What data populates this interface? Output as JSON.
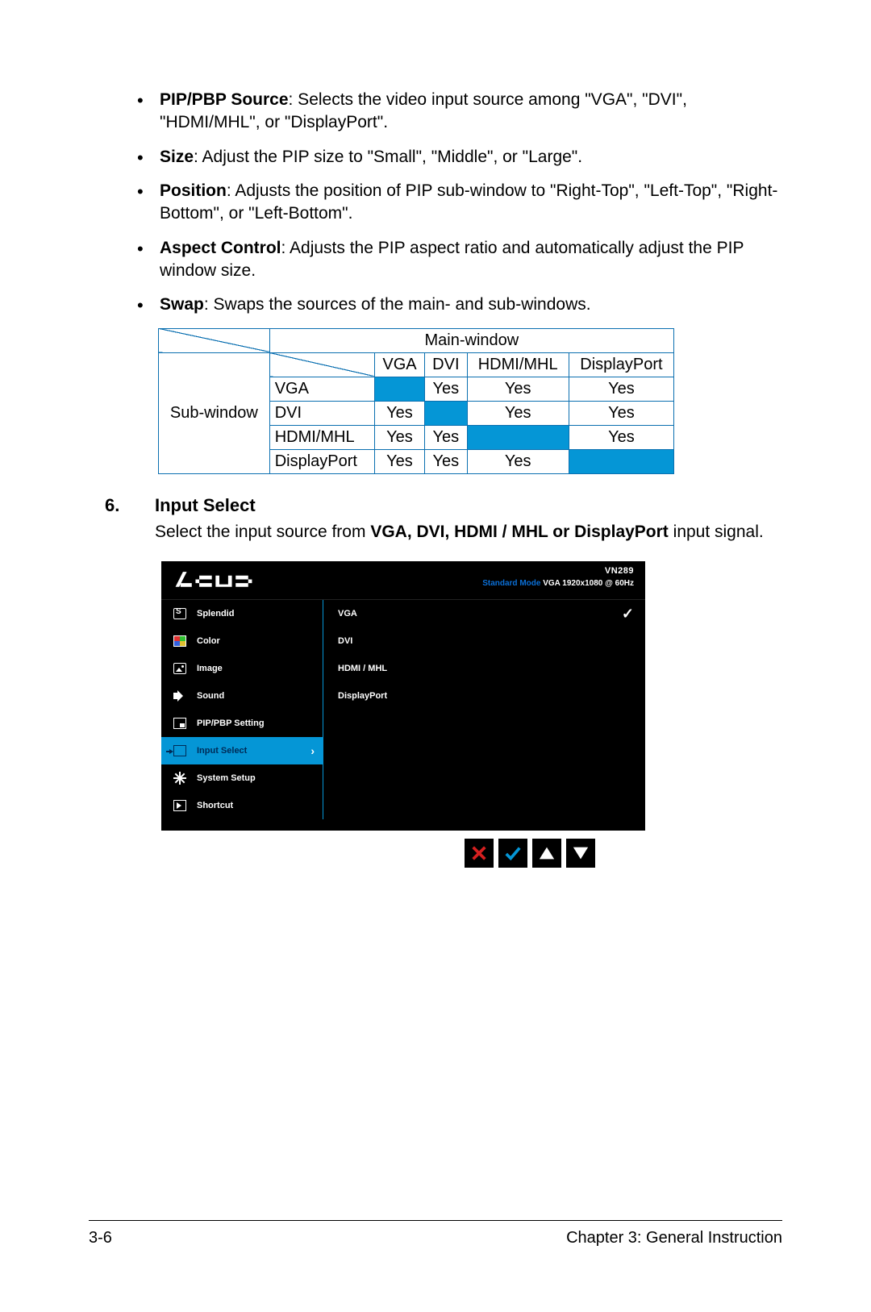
{
  "bullets": [
    {
      "label": "PIP/PBP Source",
      "text": ": Selects the video input source among \"VGA\", \"DVI\", \"HDMI/MHL\", or \"DisplayPort\"."
    },
    {
      "label": "Size",
      "text": ": Adjust the PIP size to \"Small\", \"Middle\", or \"Large\"."
    },
    {
      "label": "Position",
      "text": ": Adjusts the position of PIP sub-window to \"Right-Top\", \"Left-Top\", \"Right-Bottom\", or \"Left-Bottom\"."
    },
    {
      "label": "Aspect Control",
      "text": ": Adjusts the PIP aspect ratio and automatically adjust the PIP window size."
    },
    {
      "label": "Swap",
      "text": ": Swaps the sources of the main- and sub-windows."
    }
  ],
  "table": {
    "main_label": "Main-window",
    "sub_label": "Sub-window",
    "cols": [
      "VGA",
      "DVI",
      "HDMI/MHL",
      "DisplayPort"
    ],
    "rows": [
      {
        "name": "VGA",
        "cells": [
          "",
          "Yes",
          "Yes",
          "Yes"
        ],
        "diag": 0
      },
      {
        "name": "DVI",
        "cells": [
          "Yes",
          "",
          "Yes",
          "Yes"
        ],
        "diag": 1
      },
      {
        "name": "HDMI/MHL",
        "cells": [
          "Yes",
          "Yes",
          "",
          "Yes"
        ],
        "diag": 2
      },
      {
        "name": "DisplayPort",
        "cells": [
          "Yes",
          "Yes",
          "Yes",
          ""
        ],
        "diag": 3
      }
    ]
  },
  "section": {
    "num": "6.",
    "title": "Input Select",
    "body_pre": "Select the input source from ",
    "body_bold": "VGA, DVI, HDMI / MHL or DisplayPort",
    "body_post": " input signal."
  },
  "osd": {
    "model": "VN289",
    "status_mode": "Standard Mode",
    "status_rest": " VGA  1920x1080 @ 60Hz",
    "menu": [
      {
        "icon": "s",
        "label": "Splendid"
      },
      {
        "icon": "color",
        "label": "Color"
      },
      {
        "icon": "img",
        "label": "Image"
      },
      {
        "icon": "sound",
        "label": "Sound"
      },
      {
        "icon": "pip",
        "label": "PIP/PBP Setting"
      },
      {
        "icon": "input",
        "label": "Input Select",
        "selected": true
      },
      {
        "icon": "sys",
        "label": "System Setup"
      },
      {
        "icon": "short",
        "label": "Shortcut"
      }
    ],
    "submenu": [
      {
        "label": "VGA",
        "checked": true
      },
      {
        "label": "DVI"
      },
      {
        "label": "HDMI / MHL"
      },
      {
        "label": "DisplayPort"
      },
      {
        "label": ""
      },
      {
        "label": ""
      },
      {
        "label": ""
      },
      {
        "label": ""
      }
    ]
  },
  "footer": {
    "page": "3-6",
    "chapter": "Chapter 3: General Instruction"
  }
}
